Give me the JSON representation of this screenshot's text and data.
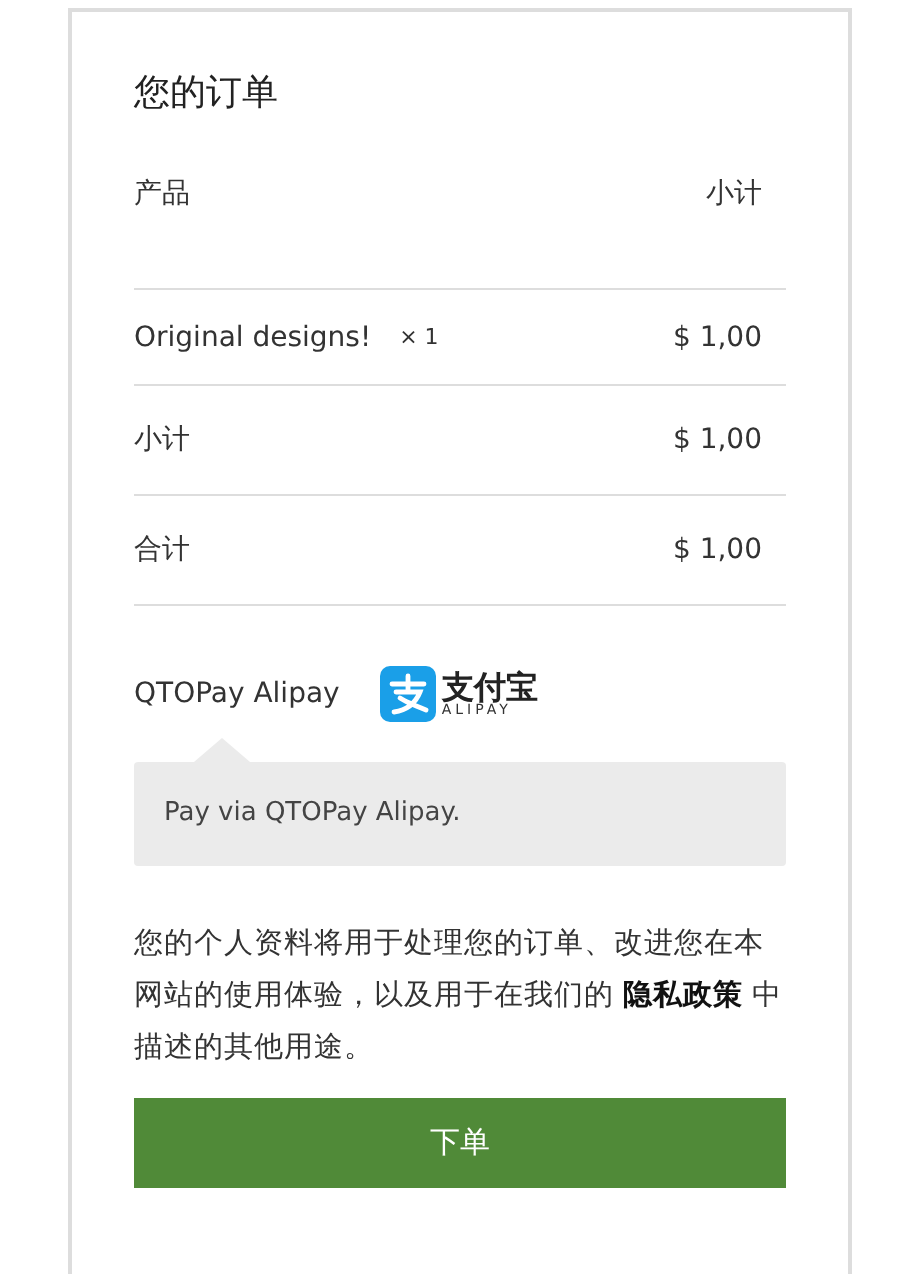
{
  "title": "您的订单",
  "table": {
    "columns": [
      "产品",
      "小计"
    ],
    "rows": [
      {
        "kind": "item",
        "label": "Original designs!",
        "quantity": "× 1",
        "amount": "$ 1,00"
      },
      {
        "kind": "total",
        "label": "小计",
        "amount": "$ 1,00"
      },
      {
        "kind": "total",
        "label": "合计",
        "amount": "$ 1,00"
      }
    ]
  },
  "payment": {
    "method": "QTOPay Alipay",
    "logo_text": "支付宝",
    "logo_subtext": "ALIPAY",
    "description": "Pay via QTOPay Alipay."
  },
  "privacy_text": "您的个人资料将用于处理您的订单、改进您在本网站的使用体验，以及用于在我们的 **隐私政策** 中描述的其他用途。",
  "button": "下单"
}
